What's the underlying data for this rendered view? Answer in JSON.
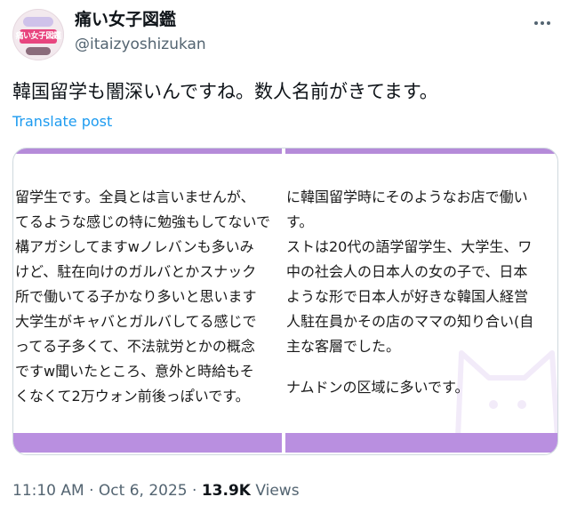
{
  "author": {
    "display_name": "痛い女子図鑑",
    "handle": "@itaizyoshizukan",
    "avatar_text": "痛い女子図鑑"
  },
  "post": {
    "text": "韓国留学も闇深いんですね。数人名前がきてます。",
    "translate_label": "Translate post"
  },
  "image": {
    "accent_color": "#b98fe0",
    "left_lines": [
      "留学生です。全員とは言いませんが、",
      "てるような感じの特に勉強もしてないで",
      "構アガシしてますwノレバンも多いみ",
      "けど、駐在向けのガルバとかスナック",
      "所で働いてる子かなり多いと思います",
      "大学生がキャバとガルバしてる感じで",
      "ってる子多くて、不法就労とかの概念",
      "ですw聞いたところ、意外と時給もそ",
      "くなくて2万ウォン前後っぽいです。"
    ],
    "right_lines": [
      "に韓国留学時にそのようなお店で働い",
      "す。",
      "ストは20代の語学留学生、大学生、ワ",
      "中の社会人の日本人の女の子で、日本",
      "ような形で日本人が好きな韓国人経営",
      "人駐在員かその店のママの知り合い(自",
      "主な客層でした。",
      "",
      "ナムドンの区域に多いです。"
    ]
  },
  "meta": {
    "time": "11:10 AM",
    "separator": "·",
    "date": "Oct 6, 2025",
    "views_count": "13.9K",
    "views_label": "Views"
  },
  "icons": {
    "more": "more-horizontal-icon"
  }
}
